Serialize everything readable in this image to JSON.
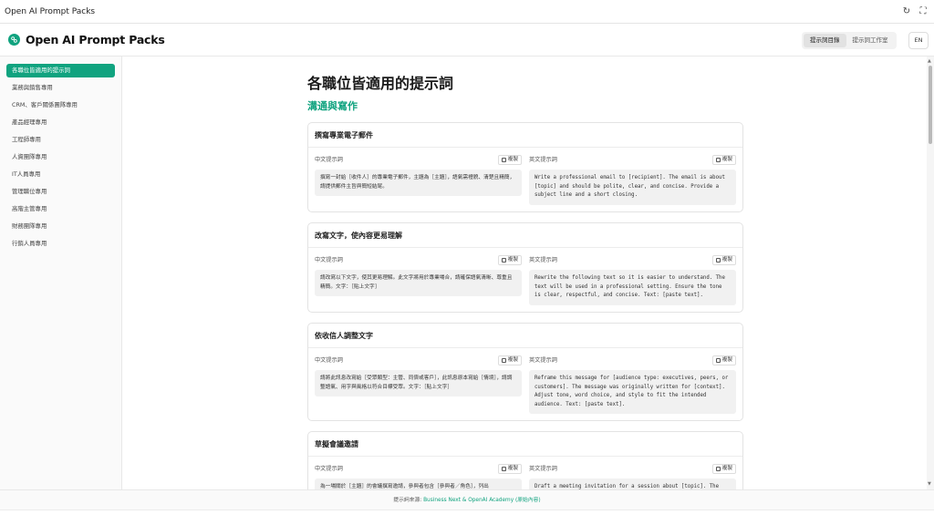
{
  "window": {
    "title": "Open AI Prompt Packs"
  },
  "header": {
    "brand": "Open AI Prompt Packs",
    "tabs": [
      "提示詞目錄",
      "提示詞工作室"
    ],
    "lang": "EN"
  },
  "sidebar": {
    "items": [
      "各職位皆適用的提示詞",
      "業務與銷售專用",
      "CRM、客戶關係團隊專用",
      "產品經理專用",
      "工程師專用",
      "人資團隊專用",
      "IT人員專用",
      "管理職位專用",
      "高階主管專用",
      "財務團隊專用",
      "行銷人員專用"
    ]
  },
  "main": {
    "page_title": "各職位皆適用的提示詞",
    "section_title": "溝通與寫作",
    "zh_label": "中文提示詞",
    "en_label": "英文提示詞",
    "copy_label": "複製",
    "cards": [
      {
        "title": "撰寫專業電子郵件",
        "zh": "撰寫一封給［收件人］的專業電子郵件，主題為［主題］，語氣需禮貌、清楚且精簡，請提供郵件主旨與簡短結尾。",
        "en": "Write a professional email to [recipient]. The email is about [topic] and should be polite, clear, and concise. Provide a subject line and a short closing."
      },
      {
        "title": "改寫文字，使內容更易理解",
        "zh": "請改寫以下文字，使其更易理解。此文字將用於專業場合，請確保語氣清晰、尊重且精簡。文字：［貼上文字］",
        "en": "Rewrite the following text so it is easier to understand. The text will be used in a professional setting. Ensure the tone is clear, respectful, and concise. Text: [paste text]."
      },
      {
        "title": "依收信人調整文字",
        "zh": "請將此訊息改寫給［受眾類型：主管、同儕或客戶］，此訊息原本寫給［情境］，請調整語氣、用字與風格以符合目標受眾。文字：［貼上文字］",
        "en": "Reframe this message for [audience type: executives, peers, or customers]. The message was originally written for [context]. Adjust tone, word choice, and style to fit the intended audience. Text: [paste text]."
      },
      {
        "title": "草擬會議邀請",
        "zh": "為一場關於［主題］的會議撰寫邀請，參與者包含［參與者／角色］，列出",
        "en": "Draft a meeting invitation for a session about [topic]. The"
      }
    ]
  },
  "footer": {
    "prefix": "提示詞來源: ",
    "link": "Business Next & OpenAI Academy (原始內容)"
  }
}
